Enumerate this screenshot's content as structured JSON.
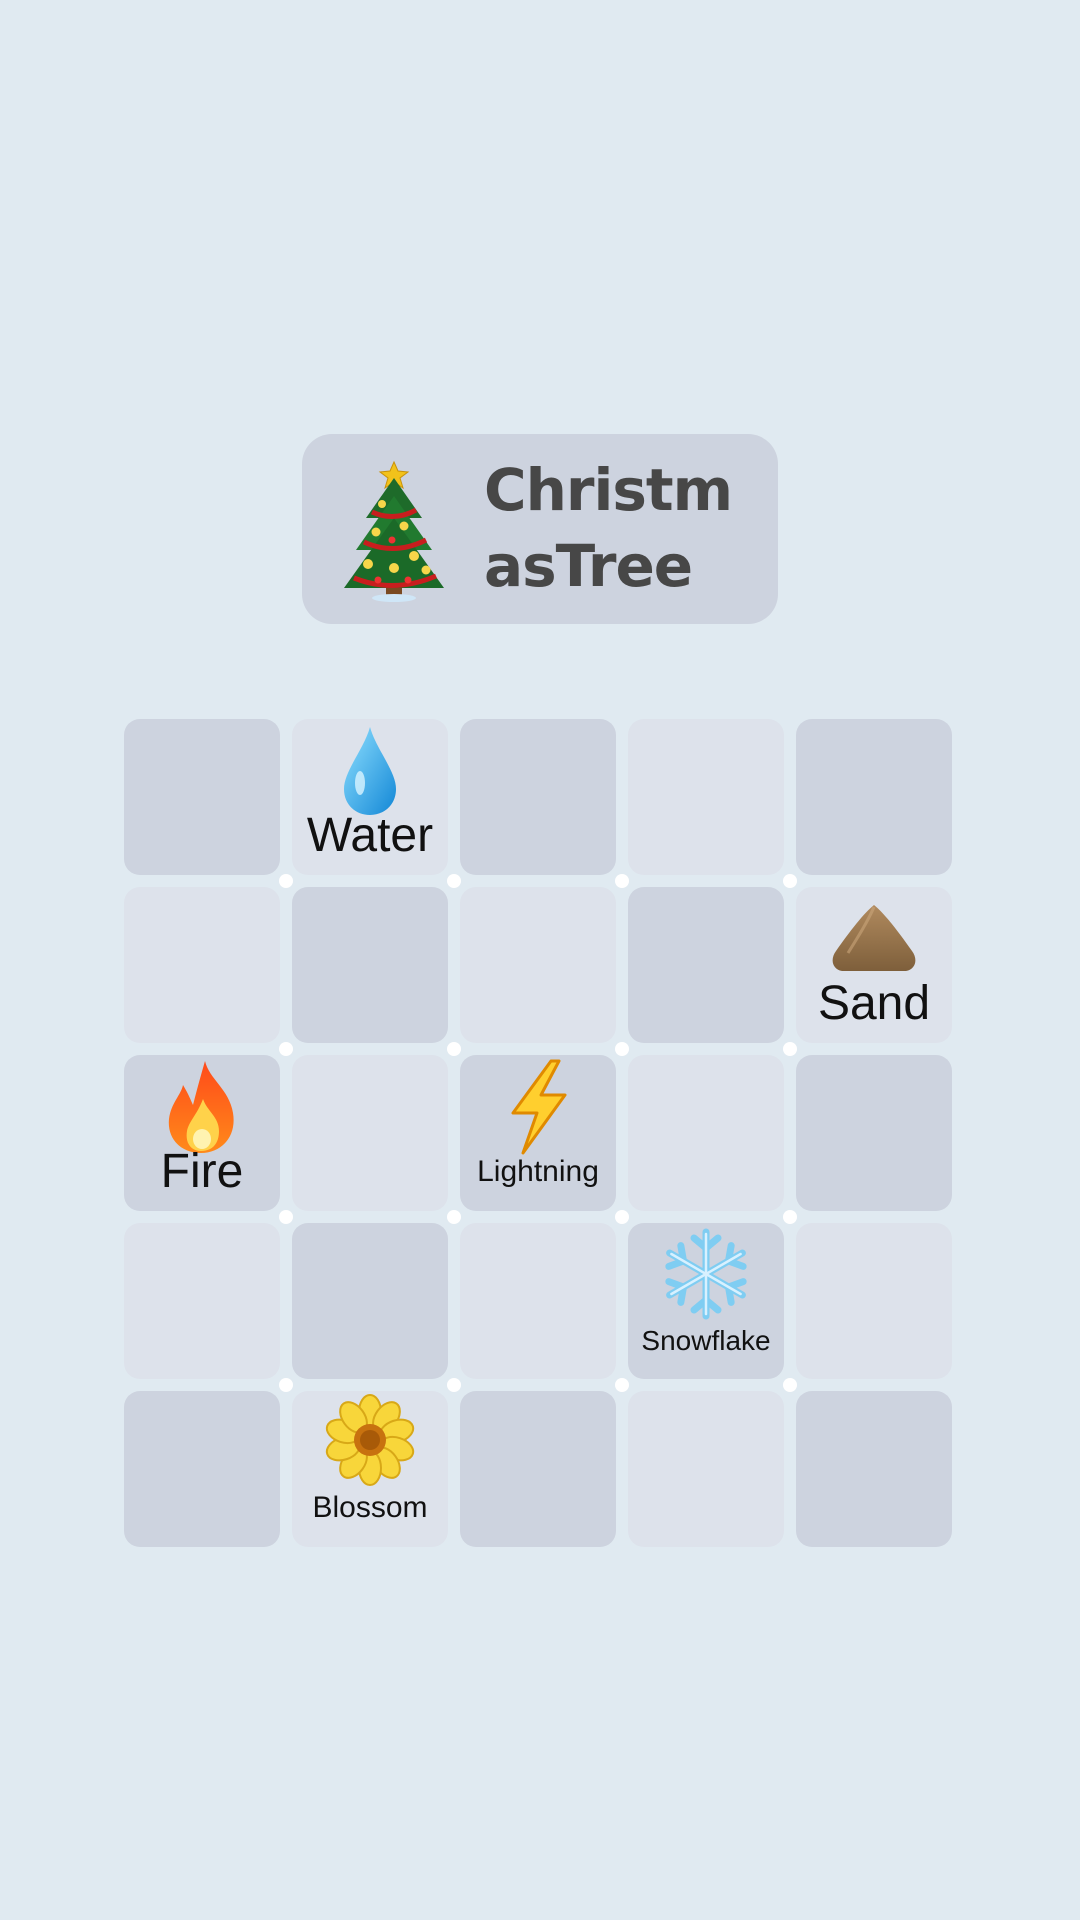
{
  "target": {
    "icon": "christmas-tree-icon",
    "title": "ChristmasTree"
  },
  "grid": {
    "rows": 5,
    "cols": 5,
    "cells": [
      [
        "",
        "Water",
        "",
        "",
        ""
      ],
      [
        "",
        "",
        "",
        "",
        "Sand"
      ],
      [
        "Fire",
        "",
        "Lightning",
        "",
        ""
      ],
      [
        "",
        "",
        "",
        "Snowflake",
        ""
      ],
      [
        "",
        "Blossom",
        "",
        "",
        ""
      ]
    ],
    "elements": {
      "water": {
        "label": "Water",
        "icon": "water-drop-icon"
      },
      "sand": {
        "label": "Sand",
        "icon": "sand-pile-icon"
      },
      "fire": {
        "label": "Fire",
        "icon": "fire-icon"
      },
      "lightning": {
        "label": "Lightning",
        "icon": "lightning-icon"
      },
      "snowflake": {
        "label": "Snowflake",
        "icon": "snowflake-icon"
      },
      "blossom": {
        "label": "Blossom",
        "icon": "blossom-icon"
      }
    }
  },
  "colors": {
    "background": "#e0eaf1",
    "cell_dark": "#cdd3df",
    "cell_light": "#dde2eb",
    "title_text": "#474747"
  }
}
